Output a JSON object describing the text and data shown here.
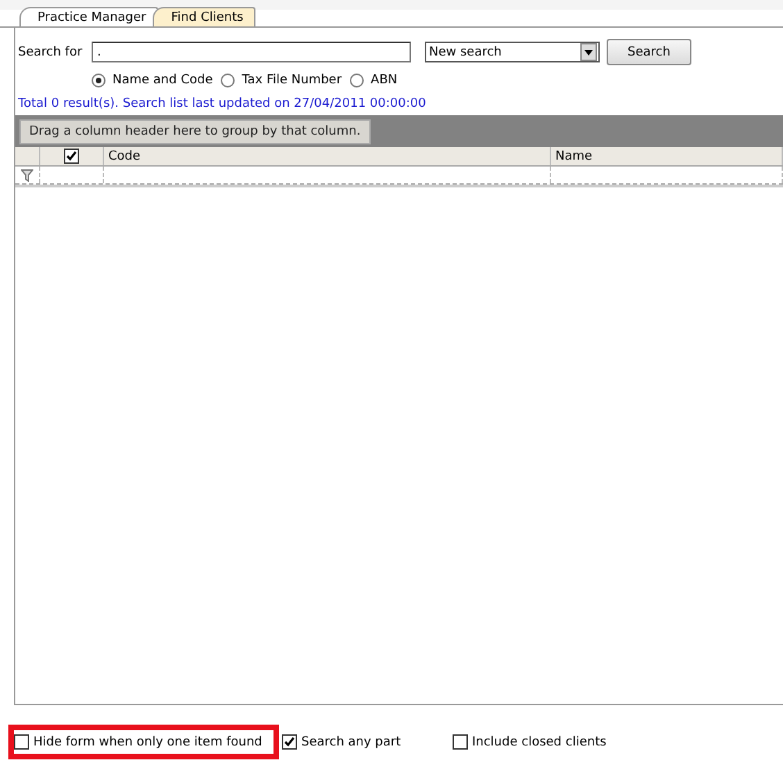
{
  "tabs": [
    {
      "label": "Practice Manager",
      "selected": false
    },
    {
      "label": "Find Clients",
      "selected": true
    }
  ],
  "search": {
    "label": "Search for",
    "value": ".",
    "mode": "New search",
    "button": "Search"
  },
  "search_by": [
    {
      "label": "Name and Code",
      "selected": true
    },
    {
      "label": "Tax File Number",
      "selected": false
    },
    {
      "label": "ABN",
      "selected": false
    }
  ],
  "status": "Total 0 result(s). Search list last updated on 27/04/2011 00:00:00",
  "grid": {
    "group_hint": "Drag a column header here to group by that column.",
    "select_all_checked": true,
    "columns": [
      "Code",
      "Name"
    ]
  },
  "options": [
    {
      "label": "Hide form when only one item found",
      "checked": false,
      "highlighted": true
    },
    {
      "label": "Search any part",
      "checked": true,
      "highlighted": false
    },
    {
      "label": "Include closed clients",
      "checked": false,
      "highlighted": false
    }
  ]
}
